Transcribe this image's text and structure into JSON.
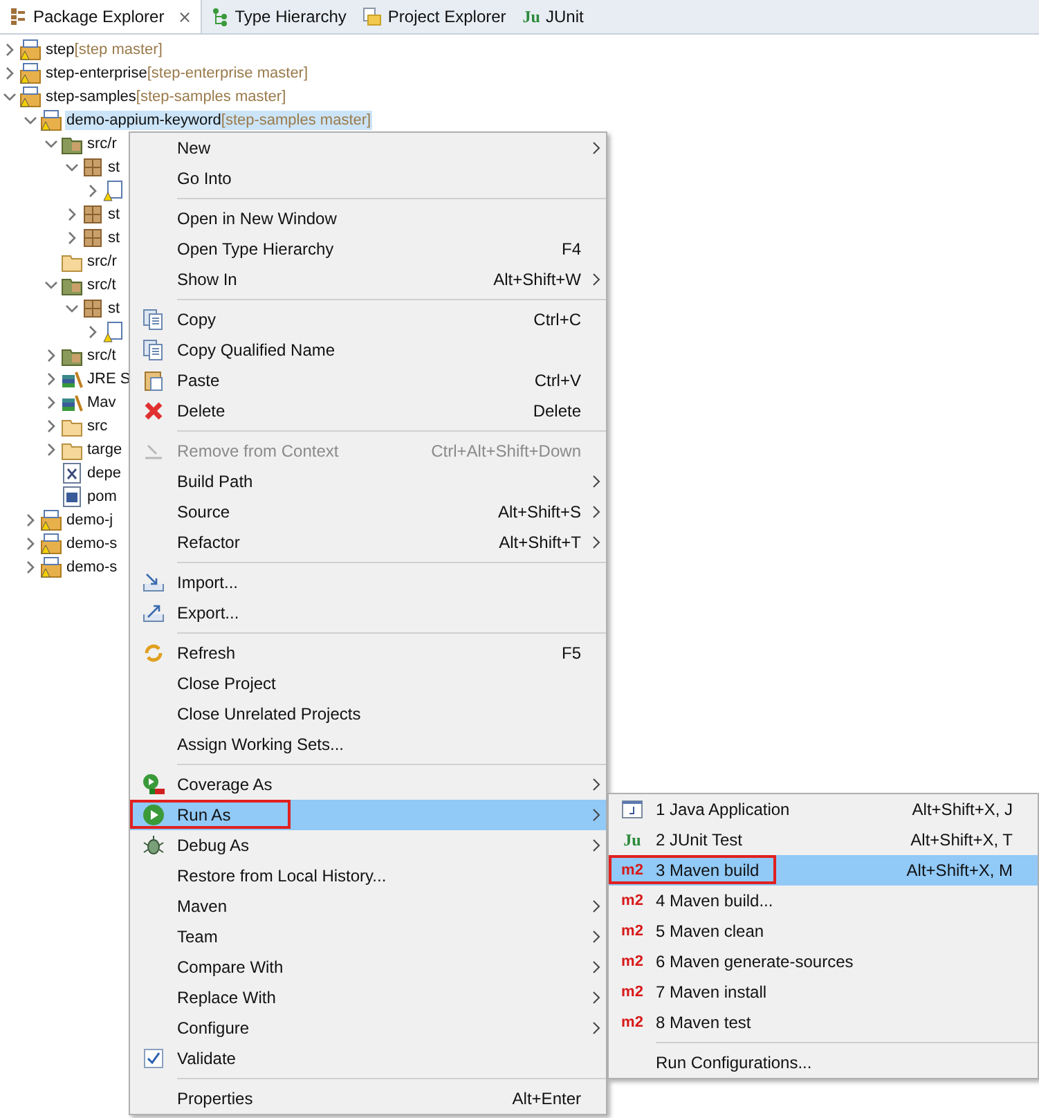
{
  "tabs": [
    {
      "label": "Package Explorer",
      "selected": true,
      "close": "⨯"
    },
    {
      "label": "Type Hierarchy",
      "selected": false
    },
    {
      "label": "Project Explorer",
      "selected": false
    },
    {
      "label": "JUnit",
      "selected": false,
      "icon_text": "Ju"
    }
  ],
  "tree": [
    {
      "label": "step",
      "branch": "[step master]",
      "kind": "project",
      "expanded": false
    },
    {
      "label": "step-enterprise",
      "branch": "[step-enterprise master]",
      "kind": "project",
      "expanded": false
    },
    {
      "label": "step-samples",
      "branch": "[step-samples master]",
      "kind": "project",
      "expanded": true,
      "children": [
        {
          "label": "demo-appium-keyword",
          "branch": "[step-samples master]",
          "kind": "project",
          "expanded": true,
          "selected": true,
          "children": [
            {
              "label": "src/r",
              "kind": "source",
              "expanded": true,
              "children": [
                {
                  "label": "st",
                  "kind": "package",
                  "expanded": true,
                  "children": [
                    {
                      "kind": "javafile",
                      "expanded": false
                    }
                  ]
                },
                {
                  "label": "st",
                  "kind": "package",
                  "expanded": false
                },
                {
                  "label": "st",
                  "kind": "package",
                  "expanded": false
                }
              ]
            },
            {
              "label": "src/r",
              "kind": "resource"
            },
            {
              "label": "src/t",
              "kind": "source",
              "expanded": true,
              "children": [
                {
                  "label": "st",
                  "kind": "package",
                  "expanded": true,
                  "children": [
                    {
                      "kind": "javafile",
                      "expanded": false
                    }
                  ]
                }
              ]
            },
            {
              "label": "src/t",
              "kind": "source",
              "expanded": false
            },
            {
              "label": "JRE S",
              "kind": "library",
              "expanded": false
            },
            {
              "label": "Mav",
              "kind": "library",
              "expanded": false
            },
            {
              "label": "src",
              "kind": "folder",
              "expanded": false
            },
            {
              "label": "targe",
              "kind": "folder",
              "expanded": false
            },
            {
              "label": "depe",
              "kind": "xml"
            },
            {
              "label": "pom",
              "kind": "pom"
            }
          ]
        },
        {
          "label": "demo-j",
          "kind": "project",
          "expanded": false,
          "selected": false
        },
        {
          "label": "demo-s",
          "kind": "project",
          "expanded": false,
          "selected": false
        },
        {
          "label": "demo-s",
          "kind": "project",
          "expanded": false,
          "selected": false
        }
      ]
    }
  ],
  "context_menu": [
    {
      "kind": "item",
      "label": "New",
      "submenu": true,
      "selected": false
    },
    {
      "kind": "item",
      "label": "Go Into",
      "selected": false
    },
    {
      "kind": "separator"
    },
    {
      "kind": "item",
      "label": "Open in New Window",
      "selected": false
    },
    {
      "kind": "item",
      "label": "Open Type Hierarchy",
      "shortcut": "F4",
      "selected": false
    },
    {
      "kind": "item",
      "label": "Show In",
      "shortcut": "Alt+Shift+W",
      "submenu": true,
      "selected": false
    },
    {
      "kind": "separator"
    },
    {
      "kind": "item",
      "label": "Copy",
      "shortcut": "Ctrl+C",
      "selected": false
    },
    {
      "kind": "item",
      "label": "Copy Qualified Name",
      "selected": false
    },
    {
      "kind": "item",
      "label": "Paste",
      "shortcut": "Ctrl+V",
      "selected": false
    },
    {
      "kind": "item",
      "label": "Delete",
      "shortcut": "Delete",
      "selected": false
    },
    {
      "kind": "separator"
    },
    {
      "kind": "item",
      "label": "Remove from Context",
      "shortcut": "Ctrl+Alt+Shift+Down",
      "disabled": true,
      "selected": false
    },
    {
      "kind": "item",
      "label": "Build Path",
      "submenu": true,
      "selected": false
    },
    {
      "kind": "item",
      "label": "Source",
      "shortcut": "Alt+Shift+S",
      "submenu": true,
      "selected": false
    },
    {
      "kind": "item",
      "label": "Refactor",
      "shortcut": "Alt+Shift+T",
      "submenu": true,
      "selected": false
    },
    {
      "kind": "separator"
    },
    {
      "kind": "item",
      "label": "Import...",
      "selected": false
    },
    {
      "kind": "item",
      "label": "Export...",
      "selected": false
    },
    {
      "kind": "separator"
    },
    {
      "kind": "item",
      "label": "Refresh",
      "shortcut": "F5",
      "selected": false
    },
    {
      "kind": "item",
      "label": "Close Project",
      "selected": false
    },
    {
      "kind": "item",
      "label": "Close Unrelated Projects",
      "selected": false
    },
    {
      "kind": "item",
      "label": "Assign Working Sets...",
      "selected": false
    },
    {
      "kind": "separator"
    },
    {
      "kind": "item",
      "label": "Coverage As",
      "submenu": true,
      "selected": false
    },
    {
      "kind": "item",
      "label": "Run As",
      "submenu": true,
      "selected": true,
      "callout": true
    },
    {
      "kind": "item",
      "label": "Debug As",
      "submenu": true,
      "selected": false
    },
    {
      "kind": "item",
      "label": "Restore from Local History...",
      "selected": false
    },
    {
      "kind": "item",
      "label": "Maven",
      "submenu": true,
      "selected": false
    },
    {
      "kind": "item",
      "label": "Team",
      "submenu": true,
      "selected": false
    },
    {
      "kind": "item",
      "label": "Compare With",
      "submenu": true,
      "selected": false
    },
    {
      "kind": "item",
      "label": "Replace With",
      "submenu": true,
      "selected": false
    },
    {
      "kind": "item",
      "label": "Configure",
      "submenu": true,
      "selected": false
    },
    {
      "kind": "item",
      "label": "Validate",
      "checked": true,
      "selected": false
    },
    {
      "kind": "separator"
    },
    {
      "kind": "item",
      "label": "Properties",
      "shortcut": "Alt+Enter",
      "selected": false
    }
  ],
  "submenu": [
    {
      "kind": "java",
      "label": "1 Java Application",
      "shortcut": "Alt+Shift+X, J",
      "selected": false
    },
    {
      "kind": "junit",
      "icon_text": "Ju",
      "label": "2 JUnit Test",
      "shortcut": "Alt+Shift+X, T",
      "selected": false
    },
    {
      "kind": "maven",
      "icon_text": "m2",
      "label": "3 Maven build",
      "shortcut": "Alt+Shift+X, M",
      "selected": true,
      "callout": true
    },
    {
      "kind": "maven",
      "icon_text": "m2",
      "label": "4 Maven build...",
      "selected": false
    },
    {
      "kind": "maven",
      "icon_text": "m2",
      "label": "5 Maven clean",
      "selected": false
    },
    {
      "kind": "maven",
      "icon_text": "m2",
      "label": "6 Maven generate-sources",
      "selected": false
    },
    {
      "kind": "maven",
      "icon_text": "m2",
      "label": "7 Maven install",
      "selected": false
    },
    {
      "kind": "maven",
      "icon_text": "m2",
      "label": "8 Maven test",
      "selected": false
    },
    {
      "kind": "separator"
    },
    {
      "kind": "plain",
      "label": "Run Configurations...",
      "selected": false
    }
  ]
}
